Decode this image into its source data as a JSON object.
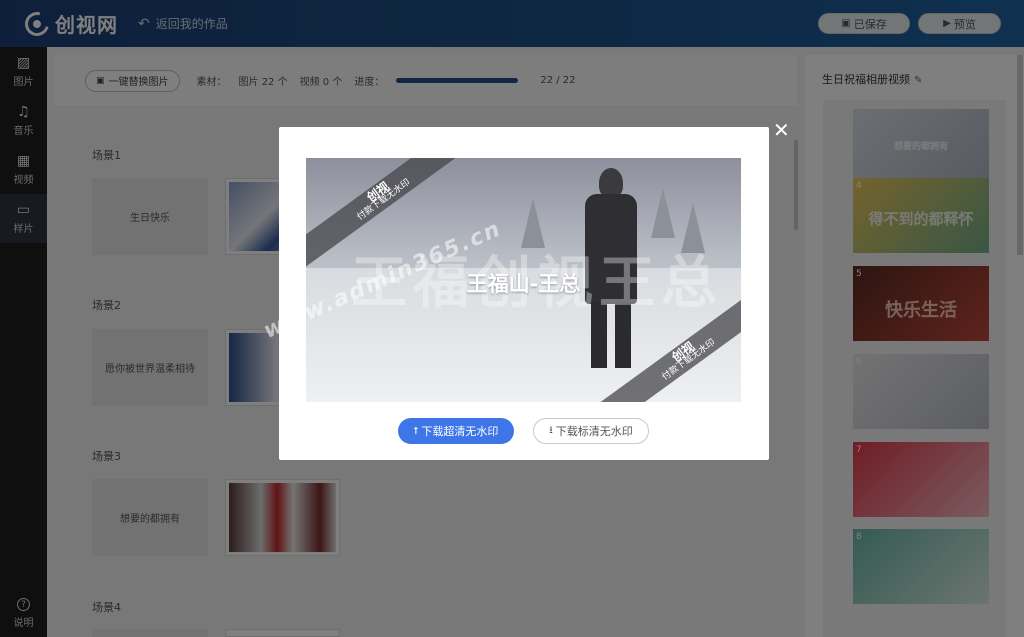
{
  "header": {
    "logo_text": "创视网",
    "back_label": "返回我的作品",
    "save_label": "已保存",
    "preview_label": "预览"
  },
  "sidebar": {
    "items": [
      {
        "label": "图片",
        "icon": "image-icon"
      },
      {
        "label": "音乐",
        "icon": "music-icon"
      },
      {
        "label": "视频",
        "icon": "film-icon"
      },
      {
        "label": "样片",
        "icon": "laptop-icon"
      }
    ],
    "help_label": "说明"
  },
  "toolbar": {
    "replace_label": "一键替换图片",
    "material_label": "素材：",
    "images_count": "图片 22 个",
    "videos_count": "视频 0 个",
    "progress_label": "进度：",
    "progress_value": 1.0,
    "progress_text": "22 / 22"
  },
  "scenes": [
    {
      "label": "场景1",
      "text": "生日快乐"
    },
    {
      "label": "场景2",
      "text": "愿你被世界温柔相待"
    },
    {
      "label": "场景3",
      "text": "想要的都拥有"
    },
    {
      "label": "场景4",
      "text": ""
    }
  ],
  "right_panel": {
    "title": "生日祝福相册视频",
    "thumbs": [
      {
        "num": "",
        "caption": "想要的都拥有"
      },
      {
        "num": "4",
        "caption": "得不到的都释怀"
      },
      {
        "num": "5",
        "caption": "快乐生活"
      },
      {
        "num": "6",
        "caption": ""
      },
      {
        "num": "7",
        "caption": ""
      },
      {
        "num": "8",
        "caption": ""
      }
    ]
  },
  "modal": {
    "video_title": "王福山-王总",
    "watermark_big": "王福创视王总",
    "banner_brand": "创视",
    "banner_sub": "付款下载无水印",
    "url_watermark": "www.admin365.cn",
    "download_hd_label": "下载超清无水印",
    "download_sd_label": "下载标清无水印",
    "close_icon": "close-icon"
  },
  "colors": {
    "header_start": "#1d3f76",
    "header_end": "#1e62a0",
    "primary_button": "#3e76e8",
    "progress_fill": "#1f4e85"
  }
}
